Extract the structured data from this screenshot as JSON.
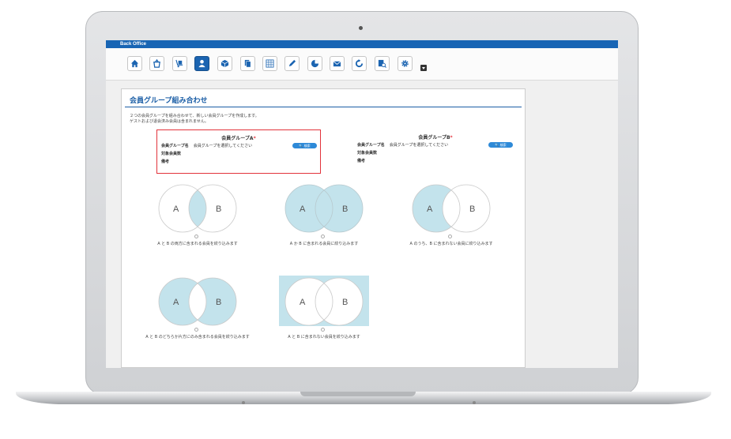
{
  "app": {
    "title": "Back Office"
  },
  "toolbar": {
    "icons": [
      "home-icon",
      "basket-icon",
      "shipping-icon",
      "member-icon",
      "box-icon",
      "document-icon",
      "grid-icon",
      "pencil-icon",
      "pie-chart-icon",
      "mail-icon",
      "refresh-icon",
      "report-icon",
      "gear-icon"
    ],
    "active": "member-icon"
  },
  "page": {
    "title": "会員グループ組み合わせ",
    "desc_line1": "２つの会員グループを組み合わせて、新しい会員グループを作成します。",
    "desc_line2": "ゲストおよび退会済み会員は含まれません。"
  },
  "group_a": {
    "title": "会員グループA",
    "required_mark": "*",
    "name_label": "会員グループ名",
    "name_placeholder": "会員グループを選択してください",
    "count_label": "対象会員数",
    "note_label": "備考",
    "search_label": "🔍 検索"
  },
  "group_b": {
    "title": "会員グループB",
    "required_mark": "*",
    "name_label": "会員グループ名",
    "name_placeholder": "会員グループを選択してください",
    "count_label": "対象会員数",
    "note_label": "備考",
    "search_label": "🔍 検索"
  },
  "venn_options": [
    {
      "a_label": "A",
      "b_label": "B",
      "caption": "A と B の両方に含まれる会員を絞り込みます"
    },
    {
      "a_label": "A",
      "b_label": "B",
      "caption": "A か B に含まれる会員に絞り込みます"
    },
    {
      "a_label": "A",
      "b_label": "B",
      "caption": "A のうち、B に含まれない会員に絞り込みます"
    },
    {
      "a_label": "A",
      "b_label": "B",
      "caption": "A と B のどちらか片方にのみ含まれる会員を絞り込みます"
    },
    {
      "a_label": "A",
      "b_label": "B",
      "caption": "A と B に含まれない会員を絞り込みます"
    }
  ],
  "colors": {
    "fill": "#c3e3ec",
    "accent": "#1b64b1",
    "selected_border": "#e2333b"
  }
}
